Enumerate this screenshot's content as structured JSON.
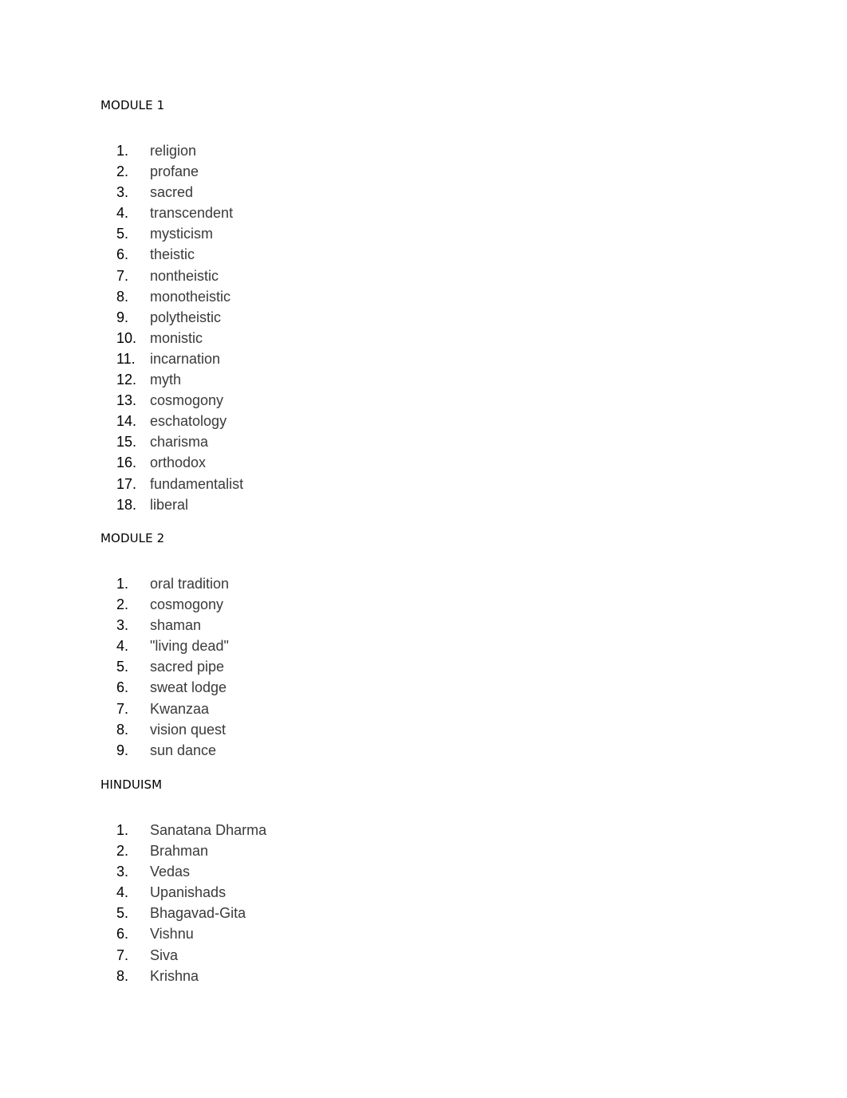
{
  "sections": [
    {
      "heading": "MODULE 1",
      "items": [
        {
          "num": "1.",
          "text": "religion"
        },
        {
          "num": "2.",
          "text": "profane"
        },
        {
          "num": "3.",
          "text": "sacred"
        },
        {
          "num": "4.",
          "text": "transcendent"
        },
        {
          "num": "5.",
          "text": "mysticism"
        },
        {
          "num": "6.",
          "text": "theistic"
        },
        {
          "num": "7.",
          "text": "nontheistic"
        },
        {
          "num": "8.",
          "text": "monotheistic"
        },
        {
          "num": "9.",
          "text": "polytheistic"
        },
        {
          "num": "10.",
          "text": "monistic"
        },
        {
          "num": "11.",
          "text": "incarnation"
        },
        {
          "num": "12.",
          "text": "myth"
        },
        {
          "num": "13.",
          "text": "cosmogony"
        },
        {
          "num": "14.",
          "text": "eschatology"
        },
        {
          "num": "15.",
          "text": "charisma"
        },
        {
          "num": "16.",
          "text": "orthodox"
        },
        {
          "num": "17.",
          "text": "fundamentalist"
        },
        {
          "num": "18.",
          "text": "liberal"
        }
      ]
    },
    {
      "heading": "MODULE 2",
      "items": [
        {
          "num": "1.",
          "text": "oral tradition"
        },
        {
          "num": "2.",
          "text": "cosmogony"
        },
        {
          "num": "3.",
          "text": "shaman"
        },
        {
          "num": "4.",
          "text": "\"living dead\""
        },
        {
          "num": "5.",
          "text": "sacred pipe"
        },
        {
          "num": "6.",
          "text": "sweat lodge"
        },
        {
          "num": "7.",
          "text": "Kwanzaa"
        },
        {
          "num": "8.",
          "text": "vision quest"
        },
        {
          "num": "9.",
          "text": "sun dance"
        }
      ]
    },
    {
      "heading": "HINDUISM",
      "items": [
        {
          "num": "1.",
          "text": "Sanatana Dharma"
        },
        {
          "num": "2.",
          "text": "Brahman"
        },
        {
          "num": "3.",
          "text": "Vedas"
        },
        {
          "num": "4.",
          "text": "Upanishads"
        },
        {
          "num": "5.",
          "text": "Bhagavad-Gita"
        },
        {
          "num": "6.",
          "text": "Vishnu"
        },
        {
          "num": "7.",
          "text": "Siva"
        },
        {
          "num": "8.",
          "text": "Krishna"
        }
      ]
    }
  ]
}
